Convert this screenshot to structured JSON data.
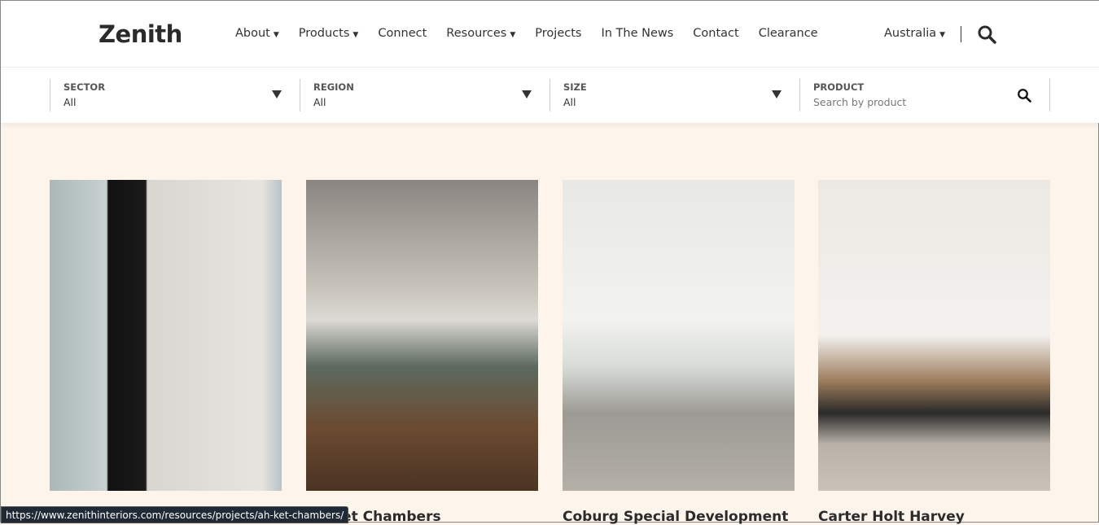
{
  "header": {
    "logo": "Zenith",
    "menu": [
      {
        "label": "About",
        "caret": true
      },
      {
        "label": "Products",
        "caret": true
      },
      {
        "label": "Connect",
        "caret": false
      },
      {
        "label": "Resources",
        "caret": true
      },
      {
        "label": "Projects",
        "caret": false
      },
      {
        "label": "In The News",
        "caret": false
      },
      {
        "label": "Contact",
        "caret": false
      },
      {
        "label": "Clearance",
        "caret": false
      }
    ],
    "country": "Australia",
    "search_icon": "search-icon"
  },
  "filters": {
    "sector": {
      "label": "SECTOR",
      "value": "All"
    },
    "region": {
      "label": "REGION",
      "value": "All"
    },
    "size": {
      "label": "SIZE",
      "value": "All"
    },
    "product": {
      "label": "PRODUCT",
      "placeholder": "Search by product"
    }
  },
  "projects": [
    {
      "title": ""
    },
    {
      "title": "Ah Ket Chambers"
    },
    {
      "title": "Coburg Special Development"
    },
    {
      "title": "Carter Holt Harvey"
    }
  ],
  "status_url": "https://www.zenithinteriors.com/resources/projects/ah-ket-chambers/",
  "colors": {
    "background": "#fdf4ec",
    "text": "#2b2b2b"
  }
}
